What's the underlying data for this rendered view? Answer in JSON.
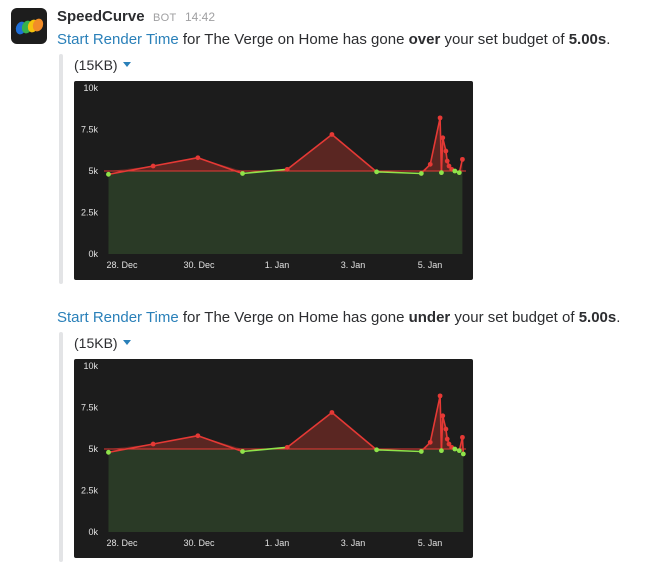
{
  "app": {
    "sender": "SpeedCurve",
    "bot_badge": "BOT",
    "time": "14:42"
  },
  "colors": {
    "link": "#2a80b9",
    "over_line": "#e53935",
    "under_line": "#8fe34a",
    "budget_line": "#e53935"
  },
  "messages": [
    {
      "metric_link": "Start Render Time",
      "text_before": " for The Verge on Home has gone ",
      "direction": "over",
      "text_after": " your set budget of ",
      "budget": "5.00s",
      "period": ".",
      "size_label": "(15KB)",
      "size_icon": "caret-down-icon"
    },
    {
      "metric_link": "Start Render Time",
      "text_before": " for The Verge on Home has gone ",
      "direction": "under",
      "text_after": " your set budget of ",
      "budget": "5.00s",
      "period": ".",
      "size_label": "(15KB)",
      "size_icon": "caret-down-icon"
    }
  ],
  "chart_data": [
    {
      "type": "line",
      "title": "",
      "xlabel": "",
      "ylabel": "",
      "y_ticks": [
        "10k",
        "7.5k",
        "5k",
        "2.5k",
        "0k"
      ],
      "x_ticks": [
        "28. Dec",
        "30. Dec",
        "1. Jan",
        "3. Jan",
        "5. Jan"
      ],
      "ylim": [
        0,
        10000
      ],
      "xlim": [
        -0.3,
        7.8
      ],
      "budget": 5000,
      "grid": false,
      "series": [
        {
          "x": [
            0,
            1,
            2,
            3,
            4,
            5,
            6,
            7,
            7.8,
            8.8,
            9.8,
            10.8,
            11.8,
            12.8,
            13.8,
            13.9,
            14.0,
            14.1,
            14.15,
            14.2,
            14.3,
            14.4,
            14.6
          ],
          "y": [
            4.8,
            5.3,
            5.8,
            4.9,
            5.1,
            7.2,
            5.0,
            4.9,
            5.0,
            5.3,
            8.2,
            6.5,
            5.8,
            5.5,
            5.1,
            4.9,
            5.0,
            5.7,
            5.2,
            5.0,
            4.9,
            5.0,
            5.8
          ]
        }
      ],
      "points": [
        {
          "x": -0.2,
          "y": 4800
        },
        {
          "x": 0.8,
          "y": 5300
        },
        {
          "x": 1.8,
          "y": 5800
        },
        {
          "x": 2.8,
          "y": 4850
        },
        {
          "x": 3.8,
          "y": 5100
        },
        {
          "x": 4.8,
          "y": 7200
        },
        {
          "x": 5.8,
          "y": 4950
        },
        {
          "x": 6.8,
          "y": 4850
        },
        {
          "x": 7.0,
          "y": 5400
        },
        {
          "x": 7.22,
          "y": 8200
        },
        {
          "x": 7.28,
          "y": 7000
        },
        {
          "x": 7.35,
          "y": 6200
        },
        {
          "x": 7.38,
          "y": 5600
        },
        {
          "x": 7.42,
          "y": 5300
        },
        {
          "x": 7.48,
          "y": 5100
        },
        {
          "x": 7.25,
          "y": 4900
        },
        {
          "x": 7.55,
          "y": 5000
        },
        {
          "x": 7.65,
          "y": 4900
        },
        {
          "x": 7.72,
          "y": 5700
        }
      ]
    },
    {
      "type": "line",
      "title": "",
      "xlabel": "",
      "ylabel": "",
      "y_ticks": [
        "10k",
        "7.5k",
        "5k",
        "2.5k",
        "0k"
      ],
      "x_ticks": [
        "28. Dec",
        "30. Dec",
        "1. Jan",
        "3. Jan",
        "5. Jan"
      ],
      "ylim": [
        0,
        10000
      ],
      "xlim": [
        -0.3,
        7.8
      ],
      "budget": 5000,
      "grid": false,
      "points": [
        {
          "x": -0.2,
          "y": 4800
        },
        {
          "x": 0.8,
          "y": 5300
        },
        {
          "x": 1.8,
          "y": 5800
        },
        {
          "x": 2.8,
          "y": 4850
        },
        {
          "x": 3.8,
          "y": 5100
        },
        {
          "x": 4.8,
          "y": 7200
        },
        {
          "x": 5.8,
          "y": 4950
        },
        {
          "x": 6.8,
          "y": 4850
        },
        {
          "x": 7.0,
          "y": 5400
        },
        {
          "x": 7.22,
          "y": 8200
        },
        {
          "x": 7.28,
          "y": 7000
        },
        {
          "x": 7.35,
          "y": 6200
        },
        {
          "x": 7.38,
          "y": 5600
        },
        {
          "x": 7.42,
          "y": 5300
        },
        {
          "x": 7.48,
          "y": 5100
        },
        {
          "x": 7.25,
          "y": 4900
        },
        {
          "x": 7.55,
          "y": 5000
        },
        {
          "x": 7.65,
          "y": 4900
        },
        {
          "x": 7.72,
          "y": 5700
        },
        {
          "x": 7.74,
          "y": 4700
        }
      ]
    }
  ]
}
